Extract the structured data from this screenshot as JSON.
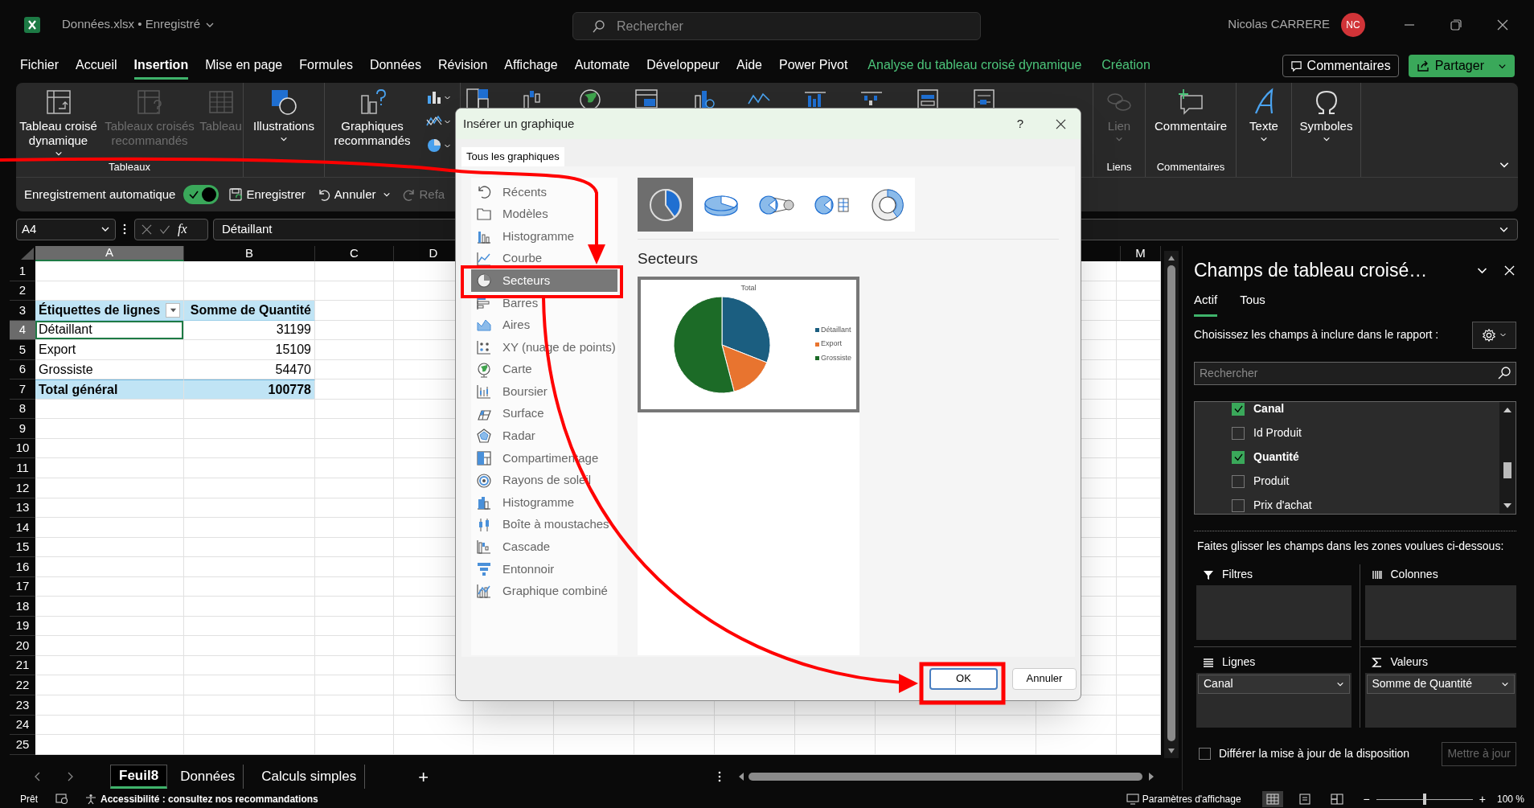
{
  "title_bar": {
    "document": "Données.xlsx • Enregistré",
    "search": {
      "placeholder": "Rechercher"
    },
    "user": "Nicolas CARRERE",
    "avatar": "NC"
  },
  "menu": [
    {
      "label": "Fichier",
      "selected": false,
      "kind": "tab"
    },
    {
      "label": "Accueil",
      "selected": false,
      "kind": "tab"
    },
    {
      "label": "Insertion",
      "selected": true,
      "kind": "tab"
    },
    {
      "label": "Mise en page",
      "selected": false,
      "kind": "tab"
    },
    {
      "label": "Formules",
      "selected": false,
      "kind": "tab"
    },
    {
      "label": "Données",
      "selected": false,
      "kind": "tab"
    },
    {
      "label": "Révision",
      "selected": false,
      "kind": "tab"
    },
    {
      "label": "Affichage",
      "selected": false,
      "kind": "tab"
    },
    {
      "label": "Automate",
      "selected": false,
      "kind": "tab"
    },
    {
      "label": "Développeur",
      "selected": false,
      "kind": "tab"
    },
    {
      "label": "Aide",
      "selected": false,
      "kind": "tab"
    },
    {
      "label": "Power Pivot",
      "selected": false,
      "kind": "tab"
    },
    {
      "label": "Analyse du tableau croisé dynamique",
      "selected": false,
      "kind": "contextual"
    },
    {
      "label": "Création",
      "selected": false,
      "kind": "contextual"
    }
  ],
  "menu_buttons": [
    {
      "label": "Commentaires",
      "kind": "comments"
    },
    {
      "label": "Partager",
      "kind": "share"
    }
  ],
  "ribbon": {
    "left_groups": [
      {
        "label": "Tableaux",
        "buttons": [
          {
            "label": "Tableau croisé dynamique",
            "kind": "pivot",
            "caret": true,
            "disabled": false
          },
          {
            "label": "Tableaux croisés recommandés",
            "kind": "pivotrec",
            "caret": false,
            "disabled": true
          },
          {
            "label": "Tableau",
            "kind": "table",
            "caret": false,
            "disabled": true
          }
        ]
      },
      {
        "buttons": [
          {
            "label": "Illustrations",
            "kind": "shapes",
            "caret": true,
            "disabled": false
          }
        ]
      },
      {
        "buttons": [
          {
            "label": "Graphiques recommandés",
            "kind": "chartrec",
            "caret": false,
            "disabled": false
          }
        ]
      }
    ],
    "right_groups": [
      {
        "label": "Liens",
        "buttons": [
          {
            "label": "Lien",
            "kind": "link",
            "caret": true,
            "disabled": true
          }
        ]
      },
      {
        "label": "Commentaires",
        "buttons": [
          {
            "label": "Commentaire",
            "kind": "comment",
            "caret": false,
            "disabled": false
          }
        ]
      },
      {
        "buttons": [
          {
            "label": "Texte",
            "kind": "text",
            "caret": true,
            "disabled": false
          }
        ]
      },
      {
        "buttons": [
          {
            "label": "Symboles",
            "kind": "symbols",
            "caret": true,
            "disabled": false
          }
        ]
      }
    ]
  },
  "quick_access": {
    "autosave": {
      "label": "Enregistrement automatique",
      "on": true
    },
    "buttons": [
      {
        "label": "Enregistrer",
        "kind": "save"
      },
      {
        "label": "Annuler",
        "kind": "undo"
      },
      {
        "label": "Refa",
        "kind": "redo"
      }
    ]
  },
  "formula_bar": {
    "name_box": "A4",
    "function_label": "fx",
    "formula": "Détaillant"
  },
  "sheet": {
    "columns": [
      {
        "label": "A",
        "selected": true
      },
      {
        "label": "B",
        "selected": false
      },
      {
        "label": "C",
        "selected": false
      },
      {
        "label": "D",
        "selected": false
      },
      {
        "label": "M",
        "selected": false
      }
    ],
    "rows": [
      {
        "number": "1",
        "selected": false,
        "kind": "empty"
      },
      {
        "number": "2",
        "selected": false,
        "kind": "empty"
      },
      {
        "number": "3",
        "selected": false,
        "kind": "header",
        "filter_button": true,
        "cells": [
          {
            "text": "Étiquettes de lignes",
            "selected": false
          },
          {
            "text": "Somme de Quantité",
            "selected": false
          }
        ]
      },
      {
        "number": "4",
        "selected": true,
        "kind": "item",
        "cells": [
          {
            "text": "Détaillant",
            "selected": true
          },
          {
            "text": "31199",
            "selected": false
          }
        ]
      },
      {
        "number": "5",
        "selected": false,
        "kind": "item",
        "cells": [
          {
            "text": "Export",
            "selected": false
          },
          {
            "text": "15109",
            "selected": false
          }
        ]
      },
      {
        "number": "6",
        "selected": false,
        "kind": "item",
        "cells": [
          {
            "text": "Grossiste",
            "selected": false
          },
          {
            "text": "54470",
            "selected": false
          }
        ]
      },
      {
        "number": "7",
        "selected": false,
        "kind": "total",
        "cells": [
          {
            "text": "Total général",
            "selected": false
          },
          {
            "text": "100778",
            "selected": false
          }
        ]
      },
      {
        "number": "8",
        "selected": false,
        "kind": "empty"
      },
      {
        "number": "9",
        "selected": false,
        "kind": "empty"
      },
      {
        "number": "10",
        "selected": false,
        "kind": "empty"
      },
      {
        "number": "11",
        "selected": false,
        "kind": "empty"
      },
      {
        "number": "12",
        "selected": false,
        "kind": "empty"
      },
      {
        "number": "13",
        "selected": false,
        "kind": "empty"
      },
      {
        "number": "14",
        "selected": false,
        "kind": "empty"
      },
      {
        "number": "15",
        "selected": false,
        "kind": "empty"
      },
      {
        "number": "16",
        "selected": false,
        "kind": "empty"
      },
      {
        "number": "17",
        "selected": false,
        "kind": "empty"
      },
      {
        "number": "18",
        "selected": false,
        "kind": "empty"
      },
      {
        "number": "19",
        "selected": false,
        "kind": "empty"
      },
      {
        "number": "20",
        "selected": false,
        "kind": "empty"
      },
      {
        "number": "21",
        "selected": false,
        "kind": "empty"
      },
      {
        "number": "22",
        "selected": false,
        "kind": "empty"
      },
      {
        "number": "23",
        "selected": false,
        "kind": "empty"
      },
      {
        "number": "24",
        "selected": false,
        "kind": "empty"
      },
      {
        "number": "25",
        "selected": false,
        "kind": "empty"
      }
    ]
  },
  "sheet_tabs": [
    {
      "label": "Feuil8",
      "selected": true
    },
    {
      "label": "Données",
      "selected": false
    },
    {
      "label": "Calculs simples",
      "selected": false
    }
  ],
  "new_sheet": "+",
  "dialog": {
    "title": "Insérer un graphique",
    "help": "?",
    "tab": "Tous les graphiques",
    "categories": [
      {
        "label": "Récents",
        "kind": "recent",
        "selected": false
      },
      {
        "label": "Modèles",
        "kind": "template",
        "selected": false
      },
      {
        "label": "Histogramme",
        "kind": "column",
        "selected": false
      },
      {
        "label": "Courbe",
        "kind": "line",
        "selected": false
      },
      {
        "label": "Secteurs",
        "kind": "pie",
        "selected": true
      },
      {
        "label": "Barres",
        "kind": "bar",
        "selected": false
      },
      {
        "label": "Aires",
        "kind": "area",
        "selected": false
      },
      {
        "label": "XY (nuage de points)",
        "kind": "scatter",
        "selected": false
      },
      {
        "label": "Carte",
        "kind": "map",
        "selected": false
      },
      {
        "label": "Boursier",
        "kind": "stock",
        "selected": false
      },
      {
        "label": "Surface",
        "kind": "surface",
        "selected": false
      },
      {
        "label": "Radar",
        "kind": "radar",
        "selected": false
      },
      {
        "label": "Compartimentage",
        "kind": "treemap",
        "selected": false
      },
      {
        "label": "Rayons de soleil",
        "kind": "sunburst",
        "selected": false
      },
      {
        "label": "Histogramme",
        "kind": "histogram",
        "selected": false
      },
      {
        "label": "Boîte à moustaches",
        "kind": "box",
        "selected": false
      },
      {
        "label": "Cascade",
        "kind": "waterfall",
        "selected": false
      },
      {
        "label": "Entonnoir",
        "kind": "funnel",
        "selected": false
      },
      {
        "label": "Graphique combiné",
        "kind": "combo",
        "selected": false
      }
    ],
    "subtypes": [
      {
        "kind": "pie",
        "selected": true
      },
      {
        "kind": "pie3d",
        "selected": false
      },
      {
        "kind": "pieofpie",
        "selected": false
      },
      {
        "kind": "barofpie",
        "selected": false
      },
      {
        "kind": "donut",
        "selected": false
      }
    ],
    "heading": "Secteurs",
    "preview": {
      "title": "Total",
      "legend": [
        {
          "label": "Détaillant",
          "color": "#1b5e80"
        },
        {
          "label": "Export",
          "color": "#e8742f"
        },
        {
          "label": "Grossiste",
          "color": "#1c6b27"
        }
      ]
    },
    "buttons": [
      {
        "label": "OK",
        "kind": "primary"
      },
      {
        "label": "Annuler",
        "kind": "secondary"
      }
    ]
  },
  "pivot_panel": {
    "title": "Champs de tableau croisé…",
    "tabs": [
      {
        "label": "Actif",
        "selected": true
      },
      {
        "label": "Tous",
        "selected": false
      }
    ],
    "instruction": "Choisissez les champs à inclure dans le rapport :",
    "search": {
      "placeholder": "Rechercher"
    },
    "fields": [
      {
        "label": "Canal",
        "checked": true
      },
      {
        "label": "Id Produit",
        "checked": false
      },
      {
        "label": "Quantité",
        "checked": true
      },
      {
        "label": "Produit",
        "checked": false
      },
      {
        "label": "Prix d'achat",
        "checked": false
      }
    ],
    "drag_hint": "Faites glisser les champs dans les zones voulues ci-dessous:",
    "areas": [
      {
        "label": "Filtres",
        "kind": "filter"
      },
      {
        "label": "Colonnes",
        "kind": "columns"
      },
      {
        "label": "Lignes",
        "kind": "rows",
        "items": [
          "Canal"
        ]
      },
      {
        "label": "Valeurs",
        "kind": "values",
        "items": [
          "Somme de Quantité"
        ]
      }
    ],
    "defer": {
      "label": "Différer la mise à jour de la disposition",
      "checked": false
    },
    "update_button": {
      "label": "Mettre à jour",
      "disabled": true
    }
  },
  "status_bar": {
    "mode": "Prêt",
    "accessibility": "Accessibilité : consultez nos recommandations",
    "display_settings": "Paramètres d'affichage",
    "views": [
      {
        "kind": "normal",
        "selected": true
      },
      {
        "kind": "page",
        "selected": false
      },
      {
        "kind": "break",
        "selected": false
      }
    ],
    "zoom_out": "−",
    "zoom_slider": {
      "level": 0.5
    },
    "zoom_in": "+",
    "zoom": "100 %"
  }
}
